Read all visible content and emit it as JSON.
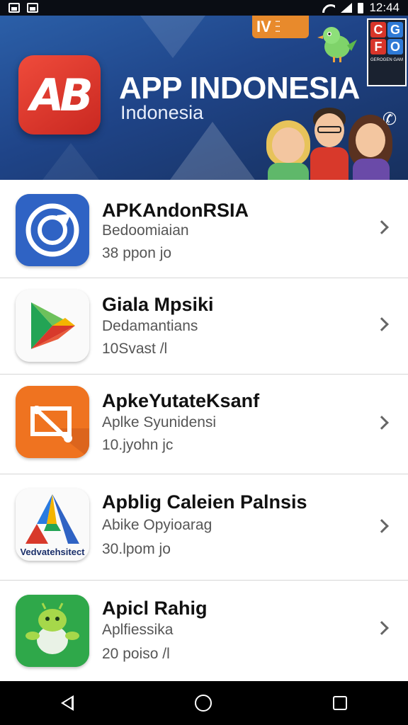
{
  "status_bar": {
    "time": "12:44"
  },
  "banner": {
    "logo_text": "AB",
    "title": "APP INDONESIA",
    "subtitle": "Indonesia",
    "tv_badge_text": "IV",
    "fo_letters": [
      "C",
      "G",
      "F",
      "O"
    ],
    "fo_caption": "GEROGEN GAM"
  },
  "apps": [
    {
      "title": "APKAndonRSIA",
      "subtitle": "Bedoomiaian",
      "meta": "38 ppon jo",
      "icon": "blue-circular-arrow-icon",
      "color": "#2f63c4"
    },
    {
      "title": "Giala Mpsiki",
      "subtitle": "Dedamantians",
      "meta": "10Svast /l",
      "icon": "play-triangle-icon",
      "color": "#ffffff"
    },
    {
      "title": "ApkeYutateKsanf",
      "subtitle": "Aplke Syunidensi",
      "meta": "10.jyohn jc",
      "icon": "orange-crop-tool-icon",
      "color": "#ef7320"
    },
    {
      "title": "Apblig Caleien Palnsis",
      "subtitle": "Abike Opyioarag",
      "meta": "30.lpom jo",
      "icon": "triangle-a-logo-icon",
      "color": "#ffffff",
      "icon_caption": "Vedvatehsitect"
    },
    {
      "title": "Apicl Rahig",
      "subtitle": "Aplfiessika",
      "meta": "20 poiso /l",
      "icon": "android-robot-icon",
      "color": "#2fa84a"
    }
  ]
}
